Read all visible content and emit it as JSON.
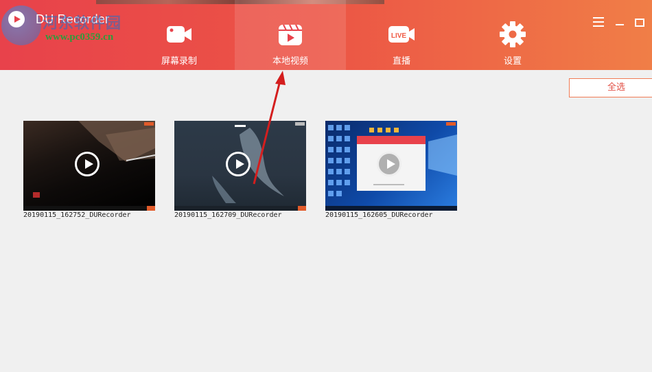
{
  "app": {
    "title": "DU Recorder"
  },
  "watermark": {
    "cn": "河东软件园",
    "url": "www.pc0359.cn"
  },
  "nav": {
    "items": [
      {
        "label": "屏幕录制",
        "icon": "video-camera-icon"
      },
      {
        "label": "本地视频",
        "icon": "clapperboard-icon",
        "active": true
      },
      {
        "label": "直播",
        "icon": "live-icon",
        "badge": "LIVE"
      },
      {
        "label": "设置",
        "icon": "gear-icon"
      }
    ]
  },
  "toolbar": {
    "select_all": "全选"
  },
  "videos": [
    {
      "filename": "20190115_162752_DURecorder"
    },
    {
      "filename": "20190115_162709_DURecorder"
    },
    {
      "filename": "20190115_162605_DURecorder"
    }
  ],
  "colors": {
    "accent": "#e8424b",
    "accent_end": "#f07e47",
    "annotation_arrow": "#d41e1e"
  }
}
